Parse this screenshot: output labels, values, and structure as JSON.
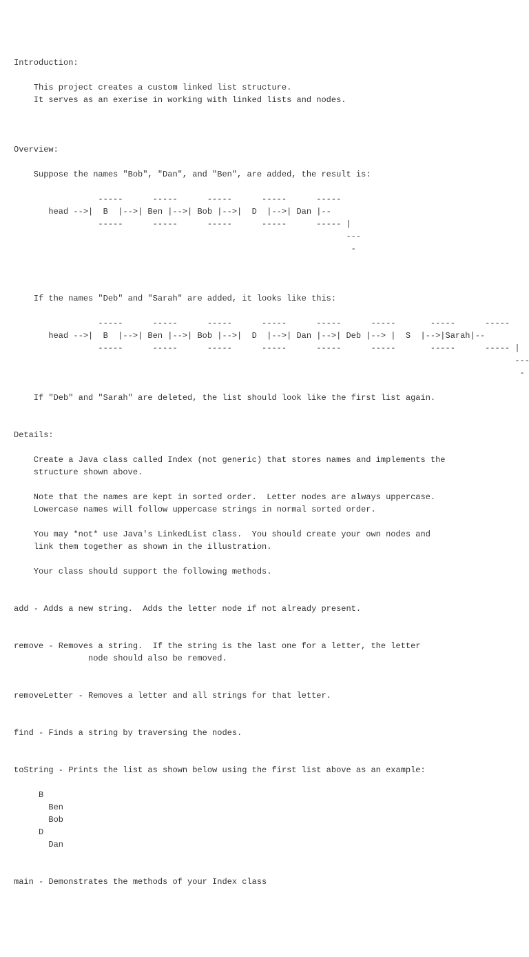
{
  "intro_heading": "Introduction:",
  "intro_p1": "    This project creates a custom linked list structure.",
  "intro_p2": "    It serves as an exerise in working with linked lists and nodes.",
  "overview_heading": "Overview:",
  "overview_p1": "    Suppose the names \"Bob\", \"Dan\", and \"Ben\", are added, the result is:",
  "diagram1_l1": "                 -----      -----      -----      -----      -----",
  "diagram1_l2": "       head -->|  B  |-->| Ben |-->| Bob |-->|  D  |-->| Dan |--",
  "diagram1_l3": "                 -----      -----      -----      -----      ----- |",
  "diagram1_l4": "                                                                   ---",
  "diagram1_l5": "                                                                    -",
  "overview_p2": "    If the names \"Deb\" and \"Sarah\" are added, it looks like this:",
  "diagram2_l1": "                 -----      -----      -----      -----      -----      -----       -----      -----",
  "diagram2_l2": "       head -->|  B  |-->| Ben |-->| Bob |-->|  D  |-->| Dan |-->| Deb |--> |  S  |-->|Sarah|--",
  "diagram2_l3": "                 -----      -----      -----      -----      -----      -----       -----      ----- |",
  "diagram2_l4": "                                                                                                     ---",
  "diagram2_l5": "                                                                                                      -",
  "overview_p3": "    If \"Deb\" and \"Sarah\" are deleted, the list should look like the first list again.",
  "details_heading": "Details:",
  "details_p1a": "    Create a Java class called Index (not generic) that stores names and implements the",
  "details_p1b": "    structure shown above.",
  "details_p2a": "    Note that the names are kept in sorted order.  Letter nodes are always uppercase.",
  "details_p2b": "    Lowercase names will follow uppercase strings in normal sorted order.",
  "details_p3a": "    You may *not* use Java's LinkedList class.  You should create your own nodes and",
  "details_p3b": "    link them together as shown in the illustration.",
  "details_p4": "    Your class should support the following methods.",
  "method_add": "add - Adds a new string.  Adds the letter node if not already present.",
  "method_remove_a": "remove - Removes a string.  If the string is the last one for a letter, the letter",
  "method_remove_b": "               node should also be removed.",
  "method_removeLetter": "removeLetter - Removes a letter and all strings for that letter.",
  "method_find": "find - Finds a string by traversing the nodes.",
  "method_toString": "toString - Prints the list as shown below using the first list above as an example:",
  "example_l1": "     B",
  "example_l2": "       Ben",
  "example_l3": "       Bob",
  "example_l4": "     D",
  "example_l5": "       Dan",
  "method_main": "main - Demonstrates the methods of your Index class"
}
